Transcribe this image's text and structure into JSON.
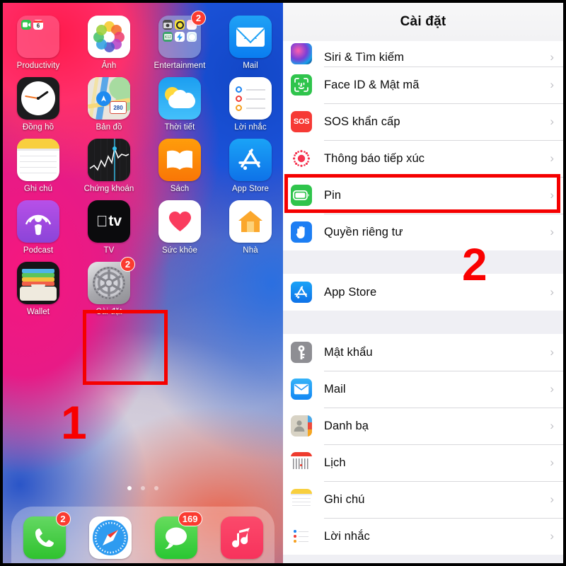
{
  "home": {
    "apps": [
      {
        "label": "Productivity",
        "icon": "folder-productivity",
        "badge": null
      },
      {
        "label": "Ảnh",
        "icon": "photos-icon",
        "badge": null
      },
      {
        "label": "Entertainment",
        "icon": "folder-entertainment",
        "badge": "2"
      },
      {
        "label": "Mail",
        "icon": "mail-icon",
        "badge": null
      },
      {
        "label": "Đồng hồ",
        "icon": "clock-icon",
        "badge": null
      },
      {
        "label": "Bản đồ",
        "icon": "maps-icon",
        "badge": null
      },
      {
        "label": "Thời tiết",
        "icon": "weather-icon",
        "badge": null
      },
      {
        "label": "Lời nhắc",
        "icon": "reminders-icon",
        "badge": null
      },
      {
        "label": "Ghi chú",
        "icon": "notes-icon",
        "badge": null
      },
      {
        "label": "Chứng khoán",
        "icon": "stocks-icon",
        "badge": null
      },
      {
        "label": "Sách",
        "icon": "books-icon",
        "badge": null
      },
      {
        "label": "App Store",
        "icon": "appstore-icon",
        "badge": null
      },
      {
        "label": "Podcast",
        "icon": "podcasts-icon",
        "badge": null
      },
      {
        "label": "TV",
        "icon": "tv-icon",
        "badge": null
      },
      {
        "label": "Sức khỏe",
        "icon": "health-icon",
        "badge": null
      },
      {
        "label": "Nhà",
        "icon": "home-icon",
        "badge": null
      },
      {
        "label": "Wallet",
        "icon": "wallet-icon",
        "badge": null
      },
      {
        "label": "Cài đặt",
        "icon": "settings-icon",
        "badge": "2"
      }
    ],
    "maps_shield_label": "280",
    "tv_label": "tv",
    "dock": [
      {
        "name": "phone-icon",
        "badge": "2"
      },
      {
        "name": "safari-icon",
        "badge": null
      },
      {
        "name": "messages-icon",
        "badge": "169"
      },
      {
        "name": "music-icon",
        "badge": null
      }
    ],
    "page_dots": {
      "count": 3,
      "active_index": 0
    }
  },
  "annotations": {
    "step_one": "1",
    "step_two": "2",
    "highlight_color": "#f50000"
  },
  "settings": {
    "title": "Cài đặt",
    "chevron": "›",
    "sections": [
      {
        "rows": [
          {
            "label": "Siri & Tìm kiếm",
            "icon": "siri-icon",
            "clipped": true
          },
          {
            "label": "Face ID & Mật mã",
            "icon": "faceid-icon"
          },
          {
            "label": "SOS khẩn cấp",
            "icon": "sos-icon",
            "icon_text": "SOS"
          },
          {
            "label": "Thông báo tiếp xúc",
            "icon": "exposure-notification-icon"
          },
          {
            "label": "Pin",
            "icon": "battery-icon",
            "highlighted": true
          },
          {
            "label": "Quyền riêng tư",
            "icon": "privacy-hand-icon"
          }
        ]
      },
      {
        "rows": [
          {
            "label": "App Store",
            "icon": "appstore-icon"
          }
        ]
      },
      {
        "rows": [
          {
            "label": "Mật khẩu",
            "icon": "password-key-icon"
          },
          {
            "label": "Mail",
            "icon": "mail-icon"
          },
          {
            "label": "Danh bạ",
            "icon": "contacts-icon"
          },
          {
            "label": "Lịch",
            "icon": "calendar-icon"
          },
          {
            "label": "Ghi chú",
            "icon": "notes-icon"
          },
          {
            "label": "Lời nhắc",
            "icon": "reminders-icon"
          }
        ]
      }
    ]
  }
}
